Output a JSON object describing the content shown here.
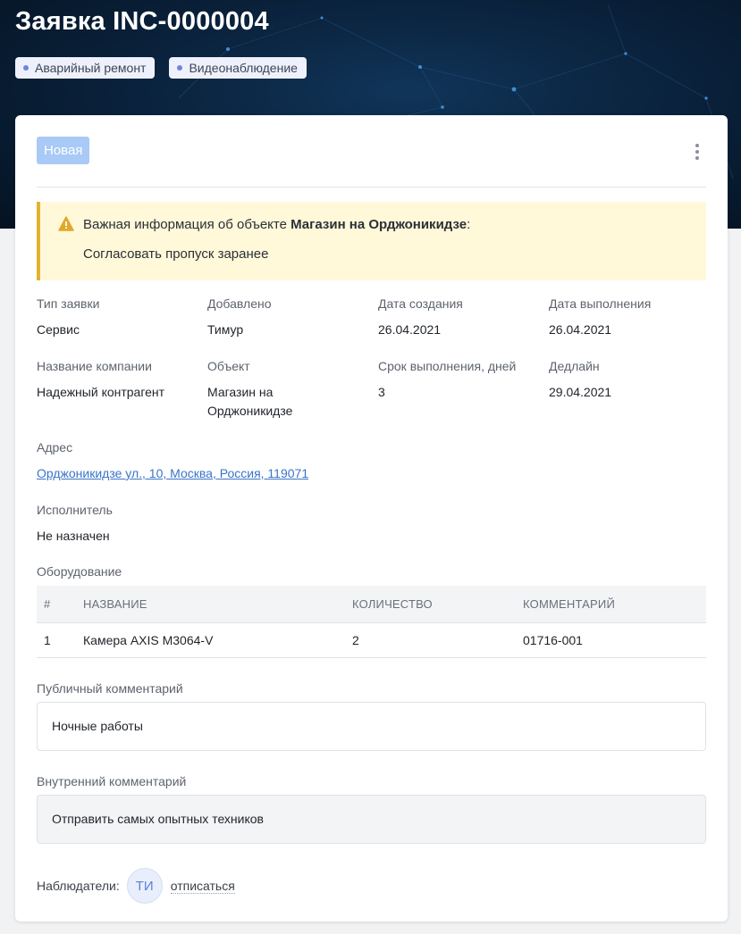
{
  "header": {
    "title": "Заявка INC-0000004",
    "tags": [
      "Аварийный ремонт",
      "Видеонаблюдение"
    ]
  },
  "status": "Новая",
  "alert": {
    "prefix": "Важная информация об объекте",
    "object": "Магазин на Орджоникидзе",
    "suffix": ":",
    "note": "Согласовать пропуск заранее"
  },
  "fields": {
    "type": {
      "label": "Тип заявки",
      "value": "Сервис"
    },
    "added": {
      "label": "Добавлено",
      "value": "Тимур"
    },
    "created": {
      "label": "Дата создания",
      "value": "26.04.2021"
    },
    "completed": {
      "label": "Дата выполнения",
      "value": "26.04.2021"
    },
    "company": {
      "label": "Название компании",
      "value": "Надежный контрагент"
    },
    "object": {
      "label": "Объект",
      "value": "Магазин на Орджоникидзе"
    },
    "term": {
      "label": "Срок выполнения, дней",
      "value": "3"
    },
    "deadline": {
      "label": "Дедлайн",
      "value": "29.04.2021"
    },
    "address": {
      "label": "Адрес",
      "value": "Орджоникидзе ул., 10, Москва, Россия, 119071"
    },
    "executor": {
      "label": "Исполнитель",
      "value": "Не назначен"
    }
  },
  "equipment": {
    "title": "Оборудование",
    "columns": [
      "#",
      "НАЗВАНИЕ",
      "КОЛИЧЕСТВО",
      "КОММЕНТАРИЙ"
    ],
    "rows": [
      [
        "1",
        "Камера AXIS M3064-V",
        "2",
        "01716-001"
      ]
    ]
  },
  "public_comment": {
    "label": "Публичный комментарий",
    "value": "Ночные работы"
  },
  "internal_comment": {
    "label": "Внутренний комментарий",
    "value": "Отправить самых опытных техников"
  },
  "watchers": {
    "label": "Наблюдатели:",
    "avatar": "ТИ",
    "unsubscribe": "отписаться"
  }
}
